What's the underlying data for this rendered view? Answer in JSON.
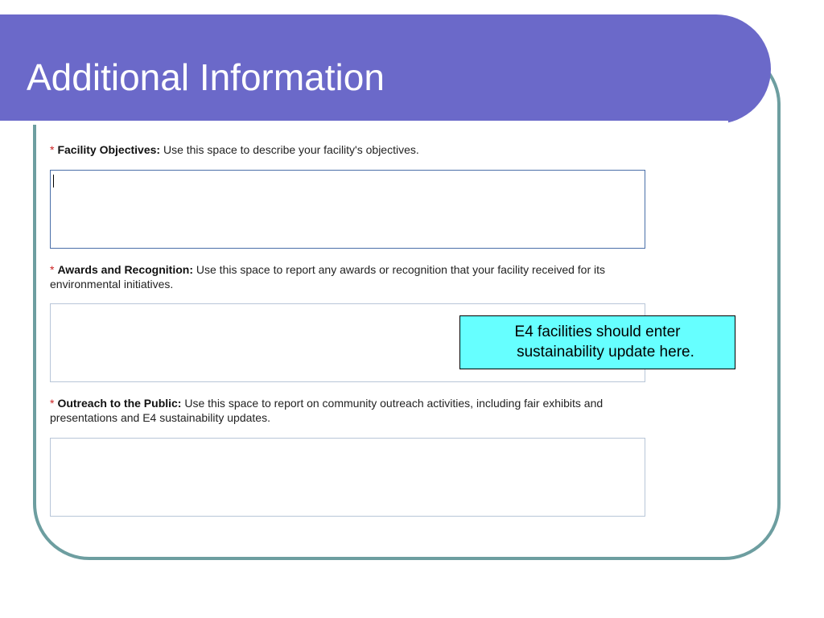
{
  "slide": {
    "title": "Additional Information"
  },
  "fields": [
    {
      "required_mark": "*",
      "label_bold": "Facility Objectives:",
      "label_text": " Use this space to describe your facility's objectives.",
      "value": ""
    },
    {
      "required_mark": "*",
      "label_bold": "Awards and Recognition:",
      "label_text": " Use this space to report any awards or recognition that your facility received for its environmental initiatives.",
      "value": ""
    },
    {
      "required_mark": "*",
      "label_bold": "Outreach to the Public:",
      "label_text": " Use this space to report on community outreach activities, including fair exhibits and presentations and E4 sustainability updates.",
      "value": ""
    }
  ],
  "callout": {
    "line1": "E4 facilities should enter",
    "line2": "sustainability update here."
  },
  "colors": {
    "title_bar": "#6b69c9",
    "frame_border": "#6d9ea0",
    "callout_fill": "#66ffff",
    "required_mark": "#cc2222"
  }
}
